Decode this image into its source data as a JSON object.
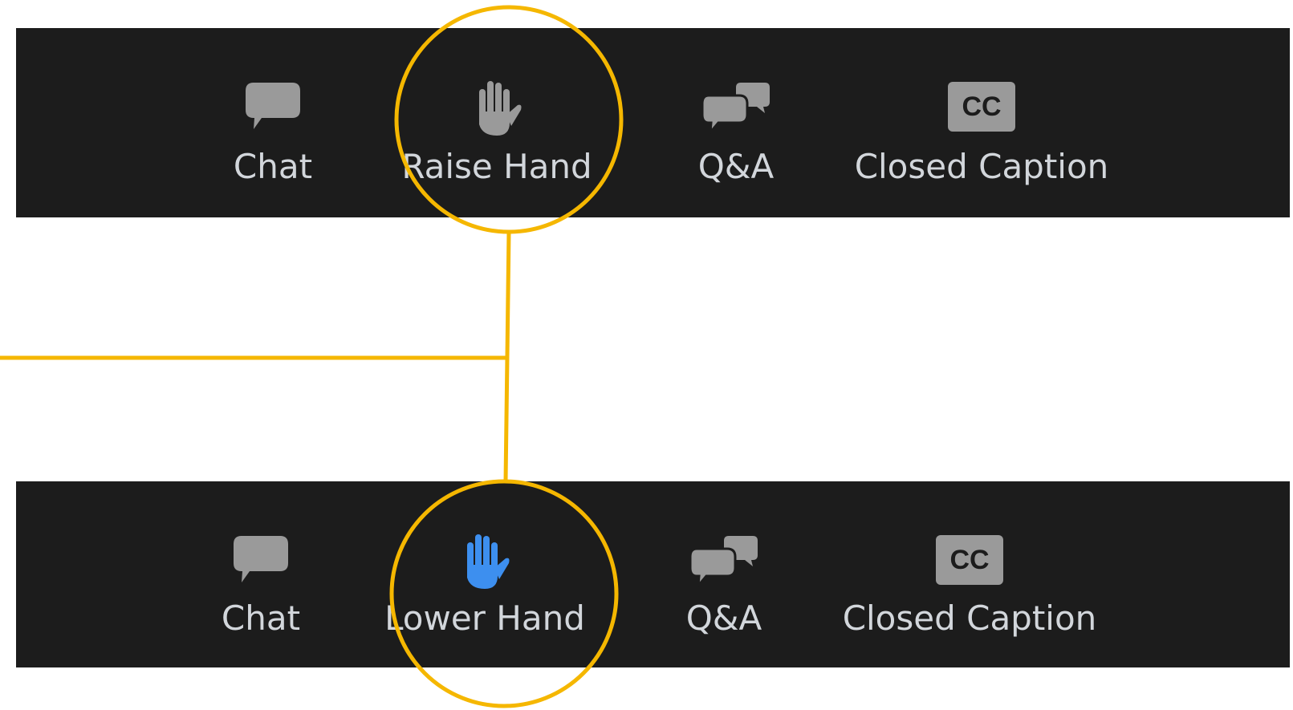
{
  "colors": {
    "toolbar_background": "#1c1c1c",
    "icon_gray": "#9a9a9a",
    "label_text": "#d2d6db",
    "raised_hand_blue": "#3d8fef",
    "highlight": "#f5b700"
  },
  "toolbar_before": {
    "buttons": [
      {
        "label": "Chat",
        "icon": "chat-bubble-icon"
      },
      {
        "label": "Raise Hand",
        "icon": "hand-icon"
      },
      {
        "label": "Q&A",
        "icon": "qa-bubbles-icon"
      },
      {
        "label": "Closed Caption",
        "icon": "cc-icon",
        "icon_text": "CC"
      }
    ]
  },
  "toolbar_after": {
    "buttons": [
      {
        "label": "Chat",
        "icon": "chat-bubble-icon"
      },
      {
        "label": "Lower Hand",
        "icon": "hand-icon-active"
      },
      {
        "label": "Q&A",
        "icon": "qa-bubbles-icon"
      },
      {
        "label": "Closed Caption",
        "icon": "cc-icon",
        "icon_text": "CC"
      }
    ]
  },
  "annotation": {
    "highlighted_items": [
      "Raise Hand",
      "Lower Hand"
    ]
  }
}
